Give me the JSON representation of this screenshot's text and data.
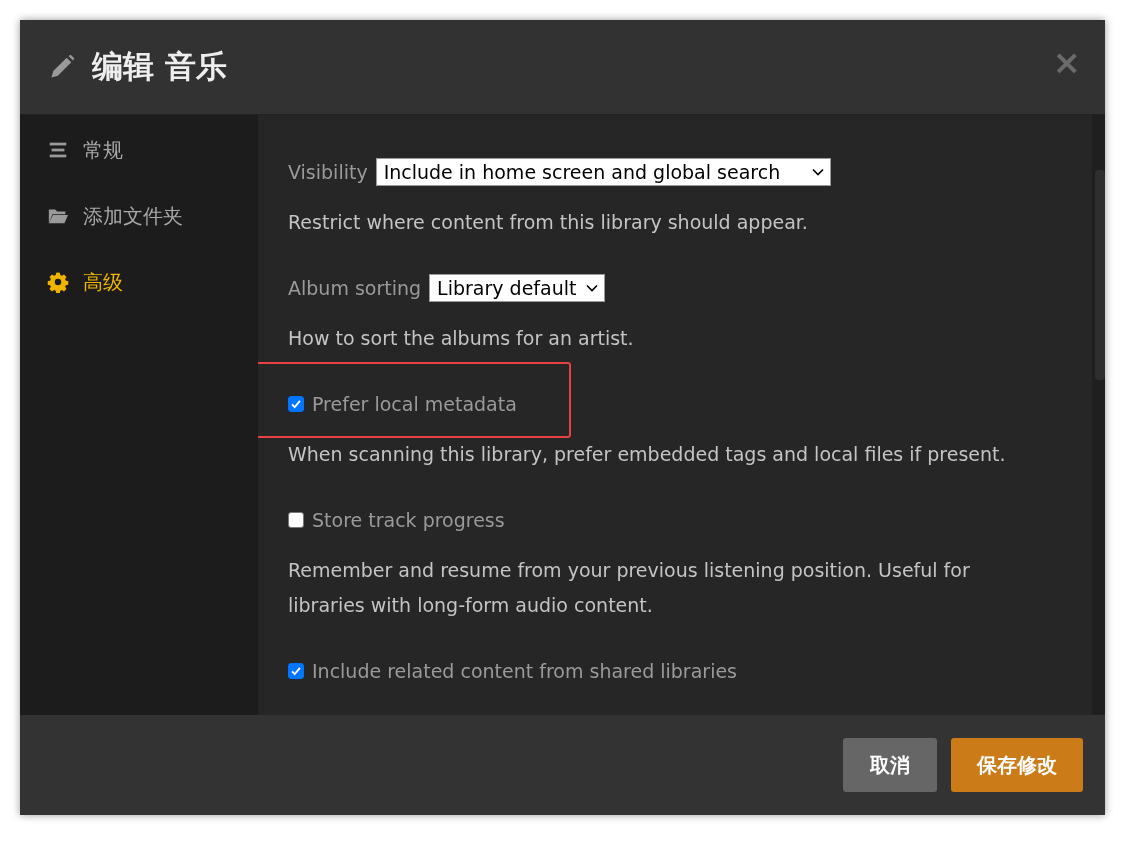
{
  "dialog": {
    "title": "编辑 音乐",
    "close": "×"
  },
  "sidebar": {
    "items": [
      {
        "label": "常规",
        "selected": false
      },
      {
        "label": "添加文件夹",
        "selected": false
      },
      {
        "label": "高级",
        "selected": true
      }
    ]
  },
  "settings": [
    {
      "kind": "select",
      "label": "Visibility",
      "value": "Include in home screen and global search",
      "description": "Restrict where content from this library should appear."
    },
    {
      "kind": "select",
      "label": "Album sorting",
      "value": "Library default",
      "description": "How to sort the albums for an artist."
    },
    {
      "kind": "checkbox",
      "label": "Prefer local metadata",
      "checked": true,
      "highlighted": true,
      "description": "When scanning this library, prefer embedded tags and local files if present."
    },
    {
      "kind": "checkbox",
      "label": "Store track progress",
      "checked": false,
      "highlighted": false,
      "description": "Remember and resume from your previous listening position. Useful for libraries with long-form audio content."
    },
    {
      "kind": "checkbox",
      "label": "Include related content from shared libraries",
      "checked": true,
      "highlighted": false
    }
  ],
  "buttons": [
    {
      "label": "取消",
      "kind": "secondary"
    },
    {
      "label": "保存修改",
      "kind": "primary"
    }
  ]
}
